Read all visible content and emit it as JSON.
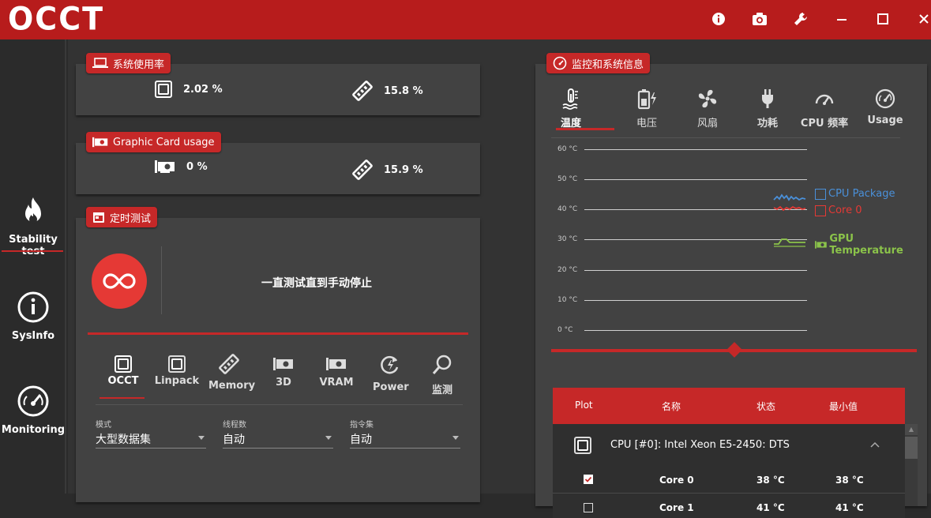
{
  "app": {
    "logo": "OCCT"
  },
  "sidebar": {
    "items": [
      {
        "label": "Stability test"
      },
      {
        "label": "SysInfo"
      },
      {
        "label": "Monitoring"
      }
    ]
  },
  "system_usage": {
    "title": "系统使用率",
    "cpu": "2.02 %",
    "ram": "15.8 %"
  },
  "gpu_usage": {
    "title": "Graphic Card usage",
    "gpu": "0 %",
    "vram": "15.9 %"
  },
  "timed_test": {
    "title": "定时测试",
    "mode_text": "一直测试直到手动停止",
    "tabs": [
      {
        "label": "OCCT"
      },
      {
        "label": "Linpack"
      },
      {
        "label": "Memory"
      },
      {
        "label": "3D"
      },
      {
        "label": "VRAM"
      },
      {
        "label": "Power"
      },
      {
        "label": "监测"
      }
    ],
    "fields": [
      {
        "label": "模式",
        "value": "大型数据集"
      },
      {
        "label": "线程数",
        "value": "自动"
      },
      {
        "label": "指令集",
        "value": "自动"
      }
    ]
  },
  "monitoring": {
    "title": "监控和系统信息",
    "tabs": [
      {
        "label": "温度"
      },
      {
        "label": "电压"
      },
      {
        "label": "风扇"
      },
      {
        "label": "功耗"
      },
      {
        "label": "CPU 频率"
      },
      {
        "label": "Usage"
      }
    ],
    "y_ticks": [
      "60 °C",
      "50 °C",
      "40 °C",
      "30 °C",
      "20 °C",
      "10 °C",
      "0 °C"
    ],
    "legend": [
      {
        "name": "CPU Package",
        "color": "#4a90d9"
      },
      {
        "name": "Core 0",
        "color": "#e53935"
      },
      {
        "name": "GPU Temperature",
        "color": "#8bc34a"
      }
    ],
    "table": {
      "headers": [
        "Plot",
        "名称",
        "状态",
        "最小值"
      ],
      "group": "CPU [#0]: Intel Xeon E5-2450: DTS",
      "rows": [
        {
          "name": "Core 0",
          "status": "38 °C",
          "min": "38 °C",
          "checked": true
        },
        {
          "name": "Core 1",
          "status": "41 °C",
          "min": "41 °C",
          "checked": false
        }
      ]
    }
  },
  "colors": {
    "accent": "#c62828",
    "titlebar": "#b71c1c",
    "panel": "#424242",
    "bg": "#333333"
  }
}
